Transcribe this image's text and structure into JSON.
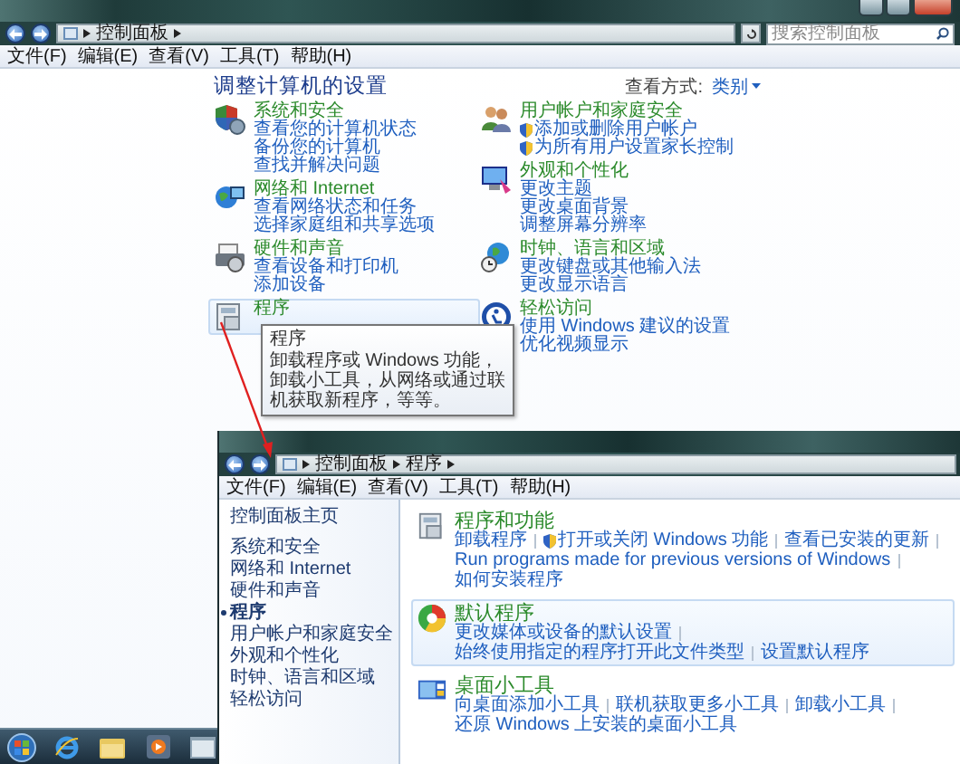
{
  "main_window": {
    "address": {
      "crumbs": [
        "控制面板"
      ]
    },
    "search": {
      "placeholder": "搜索控制面板"
    },
    "menu": [
      "文件(F)",
      "编辑(E)",
      "查看(V)",
      "工具(T)",
      "帮助(H)"
    ],
    "heading": "调整计算机的设置",
    "view_label": "查看方式:",
    "view_value": "类别",
    "left_column": [
      {
        "kind": "security",
        "title": "系统和安全",
        "highlighted": false,
        "links": [
          {
            "label": "查看您的计算机状态",
            "shielded": false
          },
          {
            "label": "备份您的计算机",
            "shielded": false
          },
          {
            "label": "查找并解决问题",
            "shielded": false
          }
        ]
      },
      {
        "kind": "network",
        "title": "网络和 Internet",
        "highlighted": false,
        "links": [
          {
            "label": "查看网络状态和任务",
            "shielded": false
          },
          {
            "label": "选择家庭组和共享选项",
            "shielded": false
          }
        ]
      },
      {
        "kind": "hardware",
        "title": "硬件和声音",
        "highlighted": false,
        "links": [
          {
            "label": "查看设备和打印机",
            "shielded": false
          },
          {
            "label": "添加设备",
            "shielded": false
          }
        ]
      },
      {
        "kind": "programs",
        "title": "程序",
        "highlighted": true,
        "tooltip": {
          "title": "程序",
          "text": "卸载程序或 Windows 功能，卸载小工具，从网络或通过联机获取新程序，等等。"
        }
      }
    ],
    "right_column": [
      {
        "kind": "users",
        "title": "用户帐户和家庭安全",
        "highlighted": false,
        "links": [
          {
            "label": "添加或删除用户帐户",
            "shielded": true
          },
          {
            "label": "为所有用户设置家长控制",
            "shielded": true
          }
        ]
      },
      {
        "kind": "appearance",
        "title": "外观和个性化",
        "highlighted": false,
        "links": [
          {
            "label": "更改主题",
            "shielded": false
          },
          {
            "label": "更改桌面背景",
            "shielded": false
          },
          {
            "label": "调整屏幕分辨率",
            "shielded": false
          }
        ]
      },
      {
        "kind": "clock",
        "title": "时钟、语言和区域",
        "highlighted": false,
        "links": [
          {
            "label": "更改键盘或其他输入法",
            "shielded": false
          },
          {
            "label": "更改显示语言",
            "shielded": false
          }
        ]
      },
      {
        "kind": "access",
        "title": "轻松访问",
        "highlighted": false,
        "links": [
          {
            "label": "使用 Windows 建议的设置",
            "shielded": false
          },
          {
            "label": "优化视频显示",
            "shielded": false
          }
        ]
      }
    ]
  },
  "programs_window": {
    "address": {
      "crumbs": [
        "控制面板",
        "程序"
      ]
    },
    "menu": [
      "文件(F)",
      "编辑(E)",
      "查看(V)",
      "工具(T)",
      "帮助(H)"
    ],
    "sidebar": [
      {
        "label": "控制面板主页",
        "kind": "home",
        "selected": false
      },
      {
        "label": "系统和安全",
        "kind": "category",
        "selected": false
      },
      {
        "label": "网络和 Internet",
        "kind": "category",
        "selected": false
      },
      {
        "label": "硬件和声音",
        "kind": "category",
        "selected": false
      },
      {
        "label": "程序",
        "kind": "category",
        "selected": true
      },
      {
        "label": "用户帐户和家庭安全",
        "kind": "category",
        "selected": false
      },
      {
        "label": "外观和个性化",
        "kind": "category",
        "selected": false
      },
      {
        "label": "时钟、语言和区域",
        "kind": "category",
        "selected": false
      },
      {
        "label": "轻松访问",
        "kind": "category",
        "selected": false
      }
    ],
    "sections": [
      {
        "kind": "programs",
        "title": "程序和功能",
        "highlighted": false,
        "links": [
          {
            "label": "卸载程序",
            "shielded": false
          },
          {
            "label": "打开或关闭 Windows 功能",
            "shielded": true
          },
          {
            "label": "查看已安装的更新",
            "shielded": false
          },
          {
            "label": "Run programs made for previous versions of Windows",
            "shielded": false
          },
          {
            "label": "如何安装程序",
            "shielded": false
          }
        ]
      },
      {
        "kind": "defaults",
        "title": "默认程序",
        "highlighted": true,
        "links": [
          {
            "label": "更改媒体或设备的默认设置",
            "shielded": false
          },
          {
            "label": "始终使用指定的程序打开此文件类型",
            "shielded": false
          },
          {
            "label": "设置默认程序",
            "shielded": false
          }
        ]
      },
      {
        "kind": "gadgets",
        "title": "桌面小工具",
        "highlighted": false,
        "links": [
          {
            "label": "向桌面添加小工具",
            "shielded": false
          },
          {
            "label": "联机获取更多小工具",
            "shielded": false
          },
          {
            "label": "卸载小工具",
            "shielded": false
          },
          {
            "label": "还原 Windows 上安装的桌面小工具",
            "shielded": false
          }
        ]
      }
    ]
  }
}
